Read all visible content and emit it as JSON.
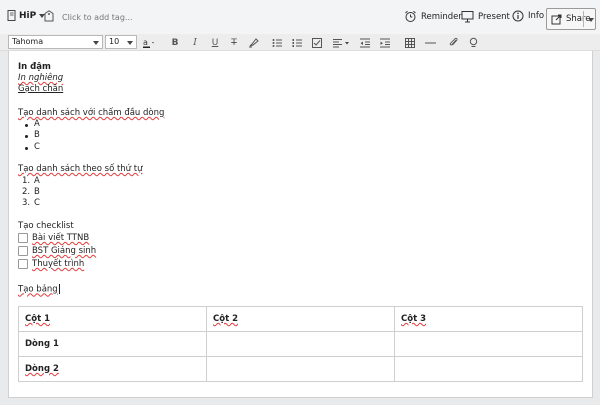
{
  "header": {
    "notebook_label": "HiP",
    "tag_placeholder": "Click to add tag...",
    "reminder_label": "Reminder",
    "present_label": "Present",
    "info_label": "Info",
    "share_label": "Share"
  },
  "format_bar": {
    "font_family": "Tahoma",
    "font_size": "10",
    "bold_label": "B",
    "italic_label": "I",
    "underline_label": "U",
    "strike_label": "T"
  },
  "note": {
    "bold_text": "In đậm",
    "italic_text": "In nghiêng",
    "underline_text": "Gạch chân",
    "bullet_heading": "Tạo danh sách với chấm đầu dòng",
    "bullets": [
      "A",
      "B",
      "C"
    ],
    "numbered_heading": "Tạo danh sách theo số thứ tự",
    "numbered": [
      {
        "num": "1.",
        "text": "A"
      },
      {
        "num": "2.",
        "text": "B"
      },
      {
        "num": "3.",
        "text": "C"
      }
    ],
    "checklist_heading": "Tạo checklist",
    "checklist": [
      "Bài viết TTNB",
      "BST Giáng sinh",
      "Thuyết trình"
    ],
    "table_heading": "Tạo bảng",
    "table": {
      "rows": [
        [
          "Cột 1",
          "Cột 2",
          "Cột 3"
        ],
        [
          "Dòng 1",
          "",
          ""
        ],
        [
          "Dòng 2",
          "",
          ""
        ]
      ]
    }
  },
  "colors": {
    "toolbar_bg": "#f3f4f5",
    "spell_underline": "#e23b3b",
    "editor_bg": "#ffffff"
  }
}
